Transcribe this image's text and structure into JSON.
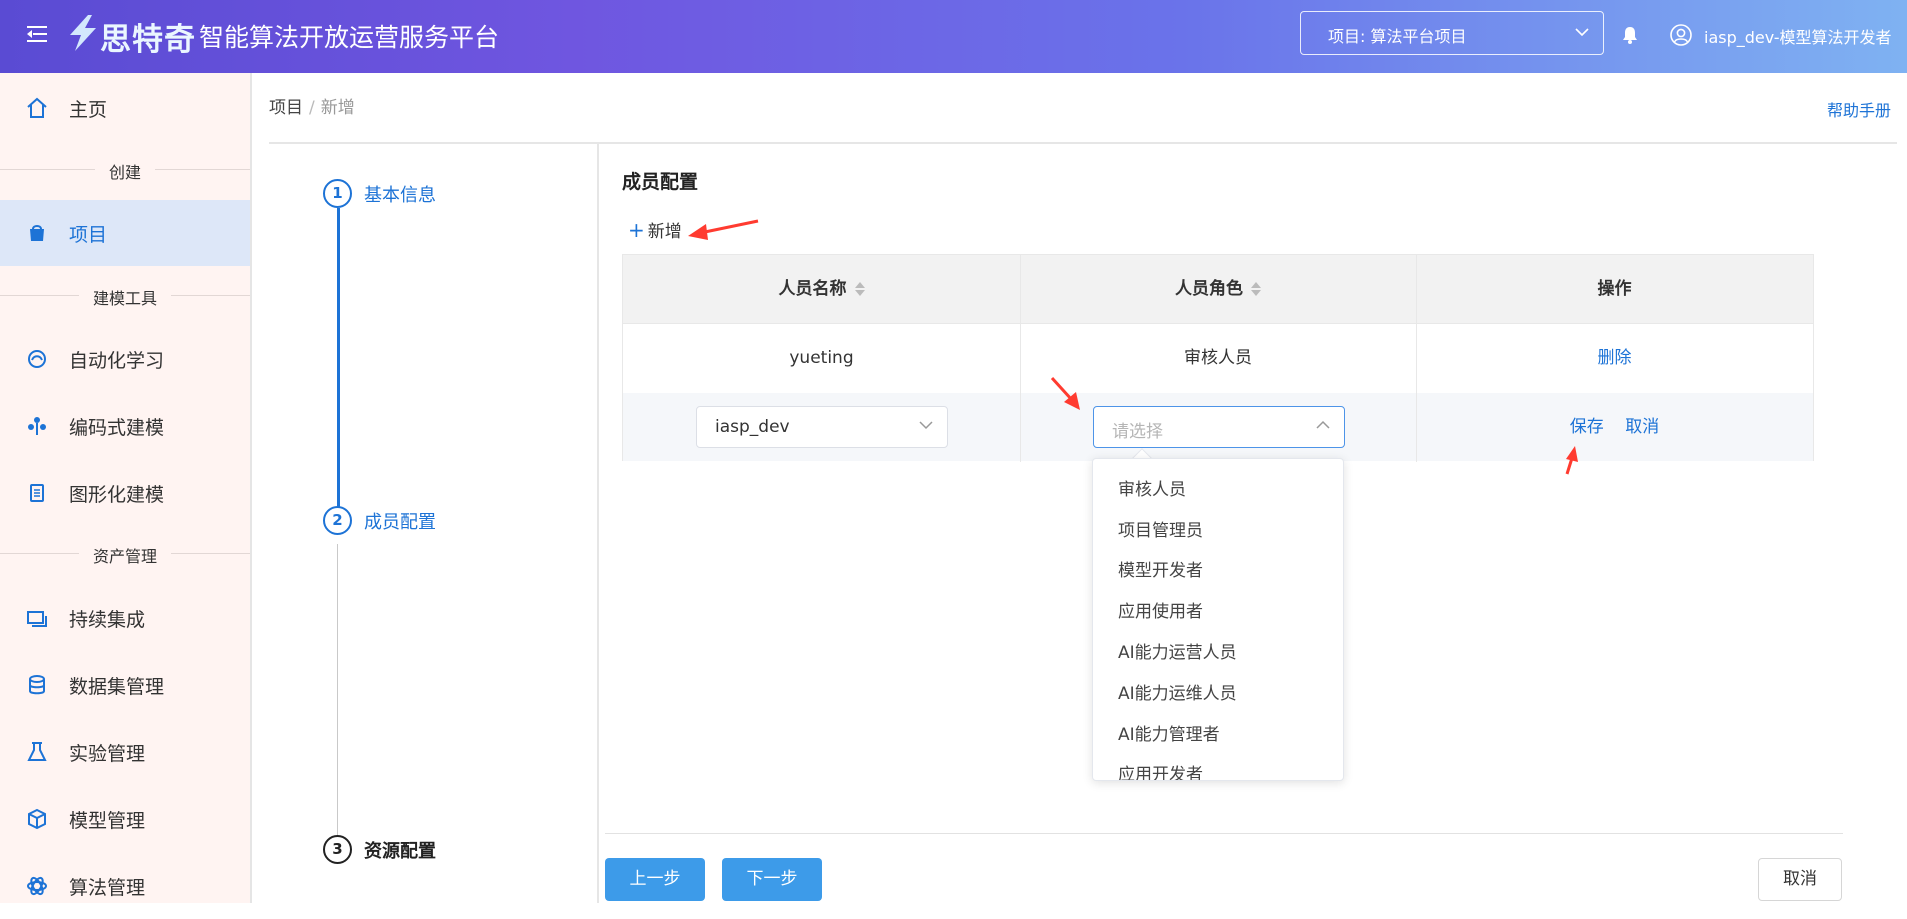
{
  "header": {
    "brand": "思特奇",
    "app_title": "智能算法开放运营服务平台",
    "project_select": "项目: 算法平台项目",
    "user": "iasp_dev-模型算法开发者"
  },
  "sidebar": {
    "home": "主页",
    "group_create": "创建",
    "project": "项目",
    "group_modeling": "建模工具",
    "items_modeling": [
      "自动化学习",
      "编码式建模",
      "图形化建模"
    ],
    "group_assets": "资产管理",
    "items_assets": [
      "持续集成",
      "数据集管理",
      "实验管理",
      "模型管理",
      "算法管理"
    ]
  },
  "breadcrumb": {
    "root": "项目",
    "separator": "/",
    "current": "新增"
  },
  "help": "帮助手册",
  "steps": [
    {
      "num": "1",
      "label": "基本信息"
    },
    {
      "num": "2",
      "label": "成员配置"
    },
    {
      "num": "3",
      "label": "资源配置"
    }
  ],
  "member": {
    "title": "成员配置",
    "add_label": "新增",
    "columns": [
      "人员名称",
      "人员角色",
      "操作"
    ],
    "rows": [
      {
        "name": "yueting",
        "role": "审核人员",
        "action": "删除"
      }
    ],
    "edit_row": {
      "name_value": "iasp_dev",
      "role_placeholder": "请选择",
      "save": "保存",
      "cancel": "取消"
    },
    "role_options": [
      "审核人员",
      "项目管理员",
      "模型开发者",
      "应用使用者",
      "AI能力运营人员",
      "AI能力运维人员",
      "AI能力管理者",
      "应用开发者"
    ]
  },
  "footer": {
    "prev": "上一步",
    "next": "下一步",
    "cancel": "取消"
  },
  "colors": {
    "accent": "#1d73d6",
    "primary_button": "#3d9be9",
    "annotation": "#ff3b30"
  }
}
